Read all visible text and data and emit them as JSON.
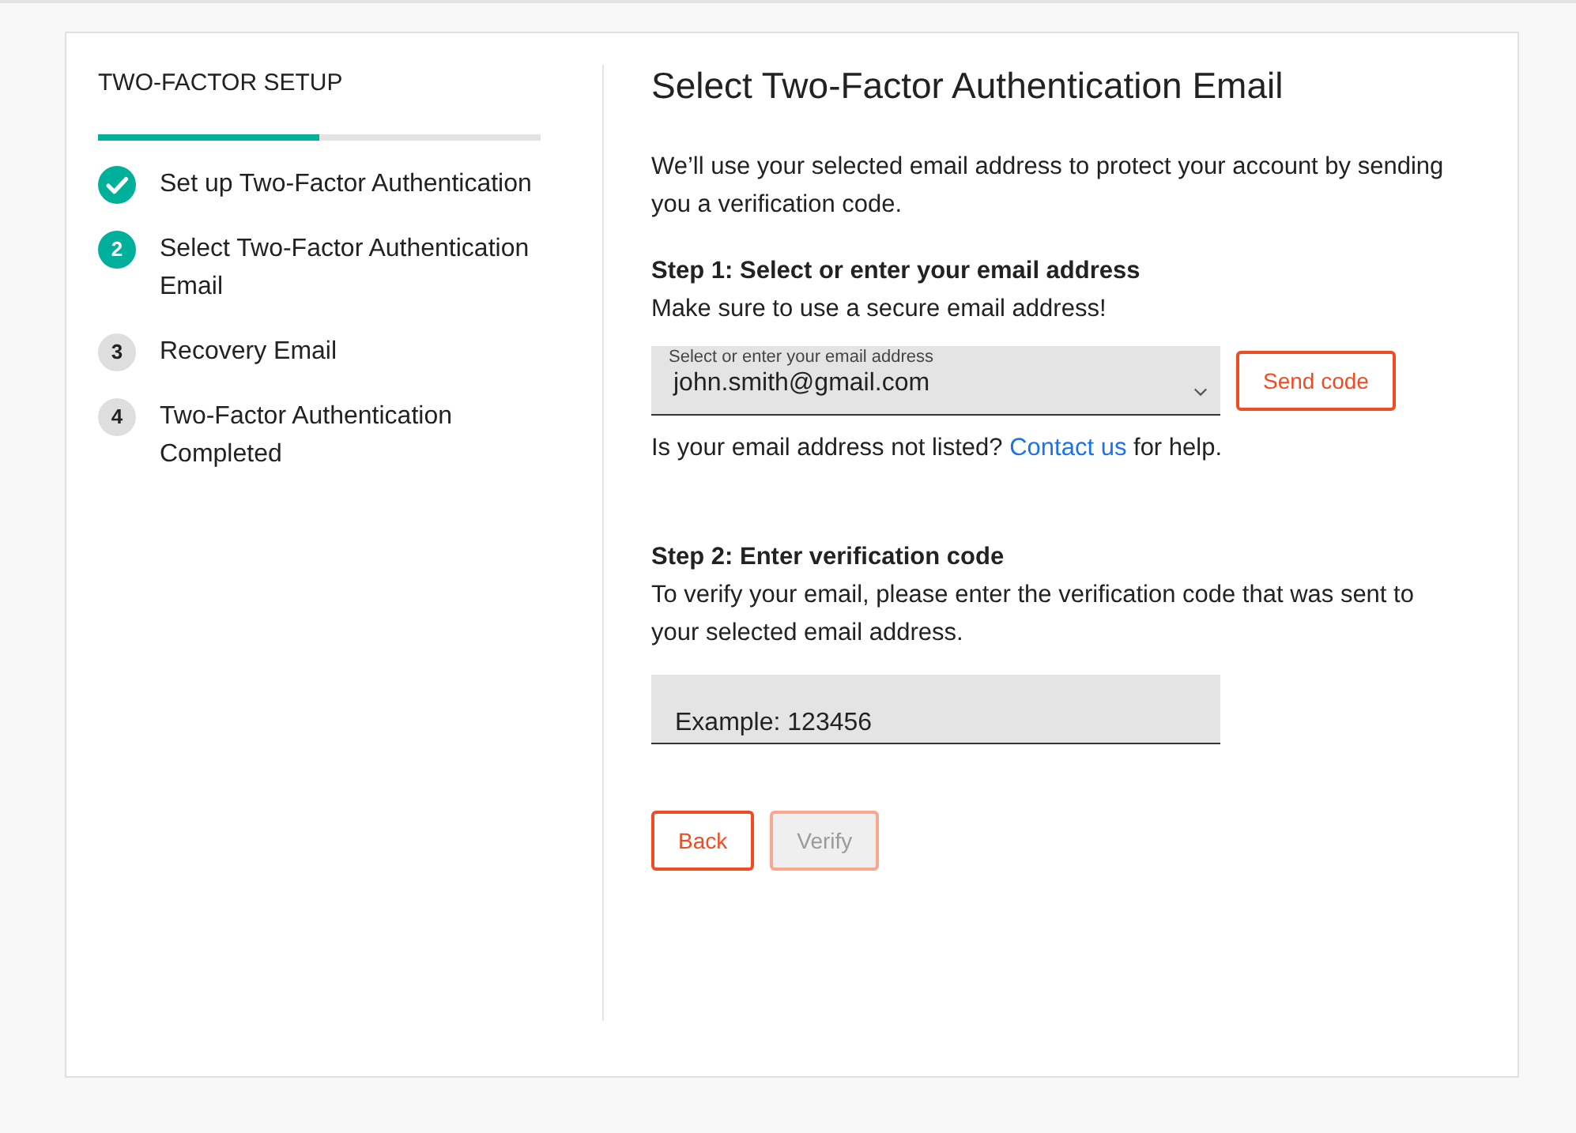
{
  "sidebar": {
    "title": "TWO-FACTOR SETUP",
    "progress": {
      "level": 0.5
    },
    "steps": [
      {
        "label": "Set up Two-Factor Authentication",
        "kind": "done"
      },
      {
        "number": "2",
        "label": "Select Two-Factor Authentication Email",
        "kind": "current"
      },
      {
        "number": "3",
        "label": "Recovery Email",
        "kind": "pending"
      },
      {
        "number": "4",
        "label": "Two-Factor Authentication Completed",
        "kind": "pending"
      }
    ]
  },
  "main": {
    "title": "Select Two-Factor Authentication Email",
    "intro": "We’ll use your selected email address to protect your account by sending you a verification code.",
    "step1": {
      "heading": "Step 1: Select or enter your email address",
      "hint": "Make sure to use a secure email address!",
      "email_select": {
        "label": "Select or enter your email address",
        "value": "john.smith@gmail.com"
      },
      "send_button": "Send code",
      "help": {
        "before": "Is your email address not listed?",
        "link": "Contact us",
        "after": "for help."
      }
    },
    "step2": {
      "heading": "Step 2: Enter verification code",
      "hint": "To verify your email, please enter the verification code that was sent to your selected email address.",
      "code_field": {
        "placeholder": "Example: 123456"
      }
    },
    "buttons": [
      {
        "label": "Back",
        "disabled": false
      },
      {
        "label": "Verify",
        "disabled": true
      }
    ]
  }
}
